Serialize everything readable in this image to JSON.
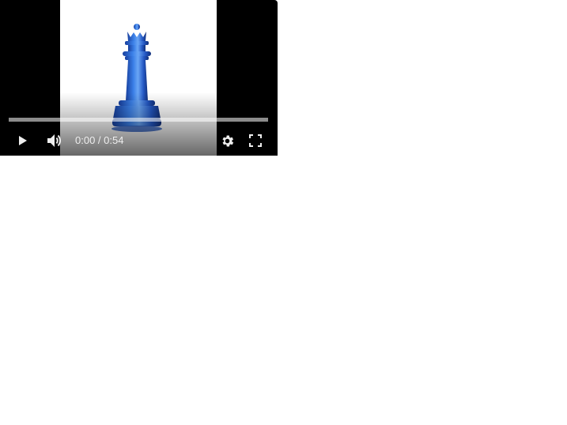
{
  "player": {
    "current_time": "0:00",
    "separator": " / ",
    "duration": "0:54",
    "progress": 0.0,
    "icons": {
      "play": "play-icon",
      "volume": "volume-icon",
      "settings": "gear-icon",
      "fullscreen": "fullscreen-icon"
    },
    "colors": {
      "letterbox": "#000000",
      "controls": "#eeeeee",
      "piece": "#2f6fd6"
    }
  }
}
